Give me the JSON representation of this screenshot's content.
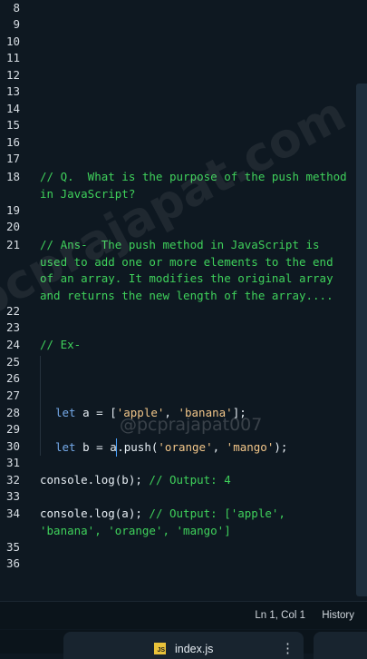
{
  "editor": {
    "line_numbers": [
      "8",
      "9",
      "10",
      "11",
      "12",
      "13",
      "14",
      "15",
      "16",
      "17",
      "18",
      "19",
      "20",
      "21",
      "22",
      "23",
      "24",
      "25",
      "26",
      "27",
      "28",
      "29",
      "30",
      "31",
      "32",
      "33",
      "34",
      "35",
      "36"
    ],
    "comment_question": "// Q.  What is the purpose of the push method in JavaScript?",
    "comment_answer": "// Ans-  The push method in JavaScript is used to add one or more elements to the end of an array. It modifies the original array and returns the new length of the array....",
    "comment_example": "// Ex-",
    "line28": {
      "kw": "let",
      "rest1": " a = [",
      "str1": "'apple'",
      "sep": ", ",
      "str2": "'banana'",
      "end": "];"
    },
    "line30": {
      "kw": "let",
      "pre": " b = a",
      "post": ".push(",
      "str1": "'orange'",
      "sep": ", ",
      "str2": "'mango'",
      "end": ");"
    },
    "line32": {
      "code": "console.log(b); ",
      "comment": "// Output: 4"
    },
    "line34": {
      "code": "console.log(a); ",
      "comment": "// Output: ['apple', 'banana', 'orange', 'mango']"
    }
  },
  "watermark": {
    "text": "pcprajapat.com",
    "handle": "@pcprajapat007"
  },
  "status_bar": {
    "cursor_position": "Ln 1, Col 1",
    "history_label": "History"
  },
  "tabs": [
    {
      "name": "index.js",
      "icon": "js-file-icon",
      "more_icon": "more-vertical-icon"
    }
  ],
  "colors": {
    "background": "#0e1821",
    "comment": "#3fd15b",
    "keyword": "#74a9e8",
    "string": "#f2c689",
    "cursor": "#4aa3ff"
  }
}
